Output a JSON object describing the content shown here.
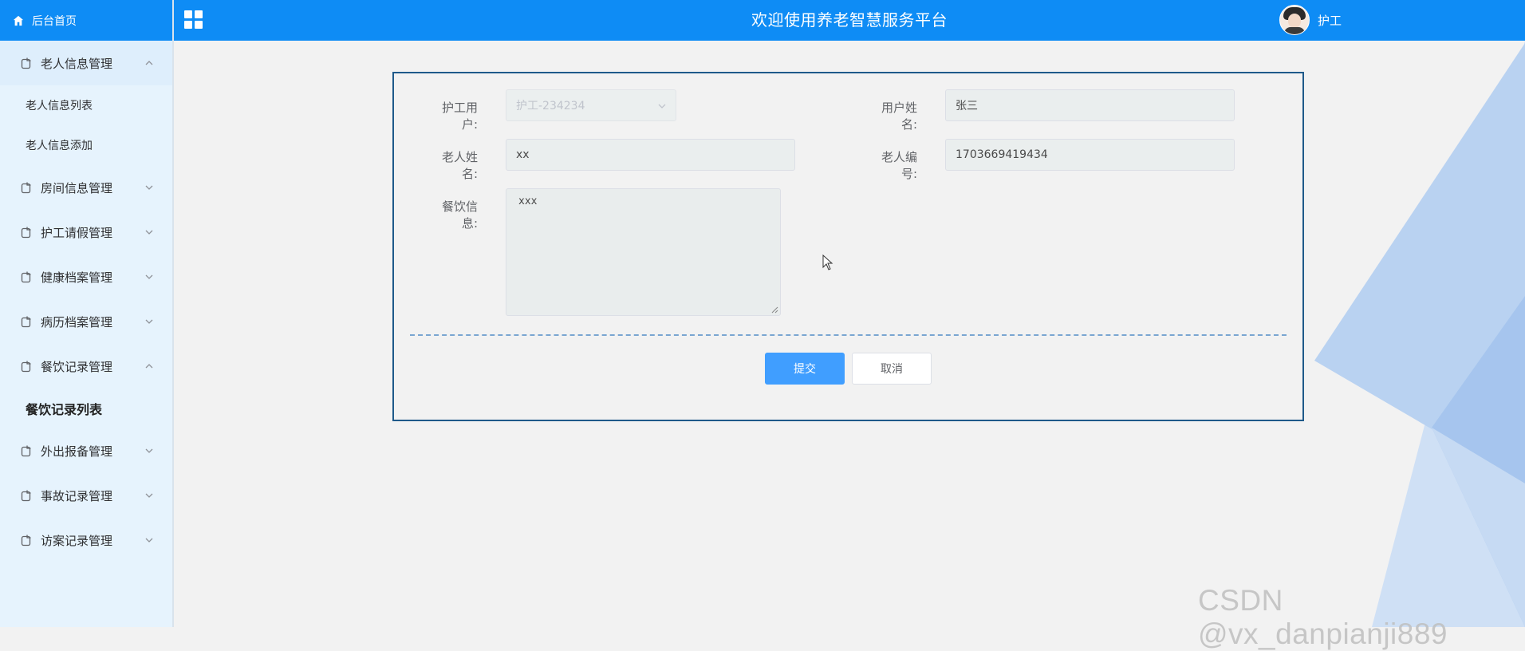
{
  "header": {
    "title": "欢迎使用养老智慧服务平台",
    "user_name": "护工",
    "accent_color": "#0e8cf5"
  },
  "sidebar": {
    "home_label": "后台首页",
    "menus": [
      {
        "label": "老人信息管理",
        "expanded": true,
        "children": [
          "老人信息列表",
          "老人信息添加"
        ]
      },
      {
        "label": "房间信息管理",
        "expanded": false
      },
      {
        "label": "护工请假管理",
        "expanded": false
      },
      {
        "label": "健康档案管理",
        "expanded": false
      },
      {
        "label": "病历档案管理",
        "expanded": false
      },
      {
        "label": "餐饮记录管理",
        "expanded": true,
        "children": [
          "餐饮记录列表"
        ]
      },
      {
        "label": "外出报备管理",
        "expanded": false
      },
      {
        "label": "事故记录管理",
        "expanded": false
      },
      {
        "label": "访案记录管理",
        "expanded": false
      }
    ],
    "active_item": "餐饮记录列表"
  },
  "form": {
    "nurse_user_label": "护工用户:",
    "nurse_user_value": "护工-234234",
    "user_name_label": "用户姓名:",
    "user_name_value": "张三",
    "elder_name_label": "老人姓名:",
    "elder_name_value": "xx",
    "elder_no_label": "老人编号:",
    "elder_no_value": "1703669419434",
    "diet_info_label": "餐饮信息:",
    "diet_info_value": "xxx",
    "submit_label": "提交",
    "cancel_label": "取消"
  },
  "watermark": "CSDN @vx_danpianji889",
  "icons": {
    "home": "home-icon",
    "grid": "grid-menu-icon",
    "menu": "document-icon",
    "chevron_up": "chevron-up-icon",
    "chevron_down": "chevron-down-icon"
  }
}
